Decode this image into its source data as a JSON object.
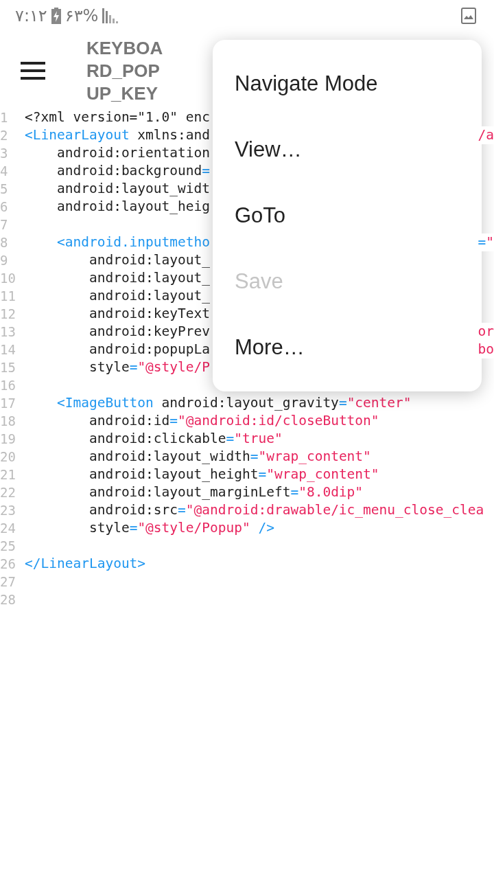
{
  "status_bar": {
    "time": "۷:۱۲",
    "battery": "۶۳%"
  },
  "toolbar": {
    "title": "KEYBOARD_POPUP_KEY"
  },
  "code_lines": [
    {
      "number": "1",
      "segments": [
        {
          "kind": "plain",
          "text": "<?xml version=\"1.0\" enc"
        }
      ]
    },
    {
      "number": "2",
      "segments": [
        {
          "kind": "tag",
          "text": "<LinearLayout"
        },
        {
          "kind": "plain",
          "text": " xmlns:and"
        }
      ],
      "tail": [
        {
          "kind": "string",
          "text": "/a"
        }
      ]
    },
    {
      "number": "3",
      "segments": [
        {
          "kind": "plain",
          "text": "    android:orientation"
        }
      ]
    },
    {
      "number": "4",
      "segments": [
        {
          "kind": "plain",
          "text": "    android:background"
        },
        {
          "kind": "eq",
          "text": "="
        }
      ]
    },
    {
      "number": "5",
      "segments": [
        {
          "kind": "plain",
          "text": "    android:layout_widt"
        }
      ]
    },
    {
      "number": "6",
      "segments": [
        {
          "kind": "plain",
          "text": "    android:layout_heig"
        }
      ]
    },
    {
      "number": "7"
    },
    {
      "number": "8",
      "segments": [
        {
          "kind": "tag",
          "text": "    <android.inputmetho"
        }
      ],
      "tail": [
        {
          "kind": "eq",
          "text": "="
        },
        {
          "kind": "string",
          "text": "\""
        }
      ]
    },
    {
      "number": "9",
      "segments": [
        {
          "kind": "plain",
          "text": "        android:layout_"
        }
      ]
    },
    {
      "number": "10",
      "segments": [
        {
          "kind": "plain",
          "text": "        android:layout_"
        }
      ]
    },
    {
      "number": "11",
      "segments": [
        {
          "kind": "plain",
          "text": "        android:layout_"
        }
      ]
    },
    {
      "number": "12",
      "segments": [
        {
          "kind": "plain",
          "text": "        android:keyText"
        }
      ]
    },
    {
      "number": "13",
      "segments": [
        {
          "kind": "plain",
          "text": "        android:keyPrev"
        }
      ],
      "tail": [
        {
          "kind": "string",
          "text": "or"
        }
      ]
    },
    {
      "number": "14",
      "segments": [
        {
          "kind": "plain",
          "text": "        android:popupLa"
        }
      ],
      "tail": [
        {
          "kind": "string",
          "text": "bo"
        }
      ]
    },
    {
      "number": "15",
      "segments": [
        {
          "kind": "plain",
          "text": "        style"
        },
        {
          "kind": "eq",
          "text": "="
        },
        {
          "kind": "string",
          "text": "\"@style/P"
        }
      ]
    },
    {
      "number": "16"
    },
    {
      "number": "17",
      "segments": [
        {
          "kind": "tag",
          "text": "    <ImageButton"
        },
        {
          "kind": "plain",
          "text": " android:layout_gravity"
        },
        {
          "kind": "eq",
          "text": "="
        },
        {
          "kind": "string",
          "text": "\"center\""
        }
      ]
    },
    {
      "number": "18",
      "segments": [
        {
          "kind": "plain",
          "text": "        android:id"
        },
        {
          "kind": "eq",
          "text": "="
        },
        {
          "kind": "string",
          "text": "\"@android:id/closeButton\""
        }
      ]
    },
    {
      "number": "19",
      "segments": [
        {
          "kind": "plain",
          "text": "        android:clickable"
        },
        {
          "kind": "eq",
          "text": "="
        },
        {
          "kind": "string",
          "text": "\"true\""
        }
      ]
    },
    {
      "number": "20",
      "segments": [
        {
          "kind": "plain",
          "text": "        android:layout_width"
        },
        {
          "kind": "eq",
          "text": "="
        },
        {
          "kind": "string",
          "text": "\"wrap_content\""
        }
      ]
    },
    {
      "number": "21",
      "segments": [
        {
          "kind": "plain",
          "text": "        android:layout_height"
        },
        {
          "kind": "eq",
          "text": "="
        },
        {
          "kind": "string",
          "text": "\"wrap_content\""
        }
      ]
    },
    {
      "number": "22",
      "segments": [
        {
          "kind": "plain",
          "text": "        android:layout_marginLeft"
        },
        {
          "kind": "eq",
          "text": "="
        },
        {
          "kind": "string",
          "text": "\"8.0dip\""
        }
      ]
    },
    {
      "number": "23",
      "segments": [
        {
          "kind": "plain",
          "text": "        android:src"
        },
        {
          "kind": "eq",
          "text": "="
        },
        {
          "kind": "string",
          "text": "\"@android:drawable/ic_menu_close_clea"
        }
      ]
    },
    {
      "number": "24",
      "segments": [
        {
          "kind": "plain",
          "text": "        style"
        },
        {
          "kind": "eq",
          "text": "="
        },
        {
          "kind": "string",
          "text": "\"@style/Popup\""
        },
        {
          "kind": "tag",
          "text": " />"
        }
      ]
    },
    {
      "number": "25"
    },
    {
      "number": "26",
      "segments": [
        {
          "kind": "tag",
          "text": "</LinearLayout>"
        }
      ]
    },
    {
      "number": "27"
    },
    {
      "number": "28"
    }
  ],
  "menu": {
    "items": [
      {
        "label": "Navigate Mode",
        "disabled": false
      },
      {
        "label": "View…",
        "disabled": false
      },
      {
        "label": "GoTo",
        "disabled": false
      },
      {
        "label": "Save",
        "disabled": true
      },
      {
        "label": "More…",
        "disabled": false
      }
    ]
  }
}
